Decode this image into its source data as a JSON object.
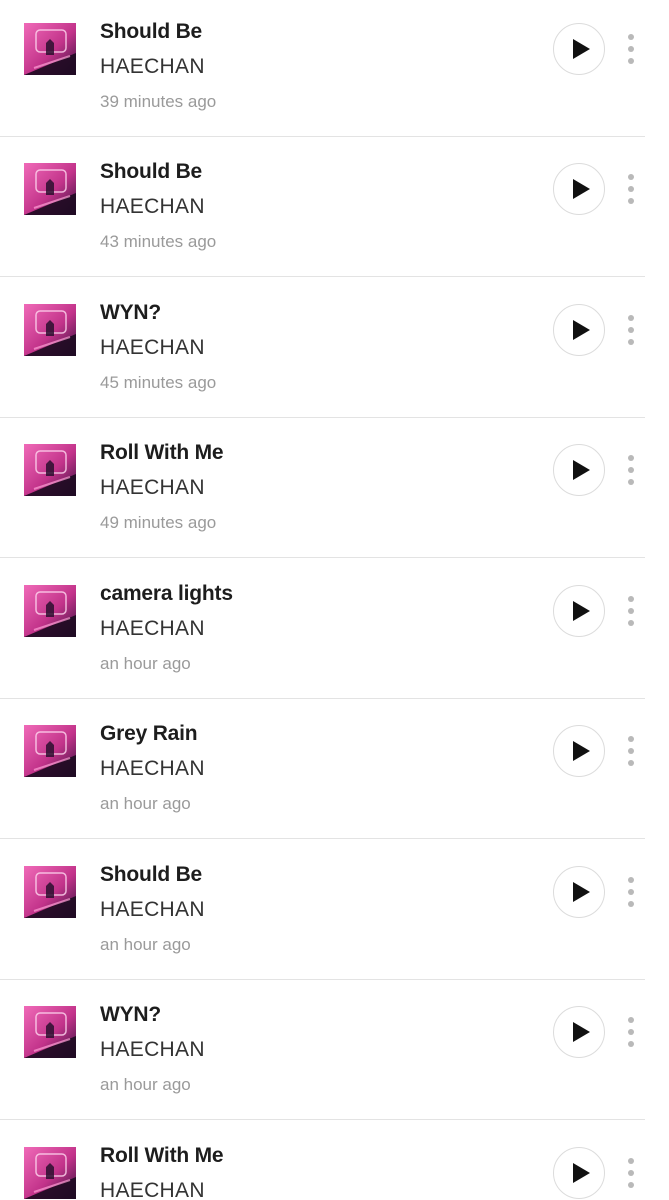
{
  "history": {
    "items": [
      {
        "title": "Should Be",
        "artist": "HAECHAN",
        "time": "39 minutes ago"
      },
      {
        "title": "Should Be",
        "artist": "HAECHAN",
        "time": "43 minutes ago"
      },
      {
        "title": "WYN?",
        "artist": "HAECHAN",
        "time": "45 minutes ago"
      },
      {
        "title": "Roll With Me",
        "artist": "HAECHAN",
        "time": "49 minutes ago"
      },
      {
        "title": "camera lights",
        "artist": "HAECHAN",
        "time": "an hour ago"
      },
      {
        "title": "Grey Rain",
        "artist": "HAECHAN",
        "time": "an hour ago"
      },
      {
        "title": "Should Be",
        "artist": "HAECHAN",
        "time": "an hour ago"
      },
      {
        "title": "WYN?",
        "artist": "HAECHAN",
        "time": "an hour ago"
      },
      {
        "title": "Roll With Me",
        "artist": "HAECHAN",
        "time": ""
      }
    ]
  },
  "icons": {
    "play": "play-icon",
    "more": "more-vertical-icon",
    "cover": "album-cover"
  },
  "colors": {
    "title": "#1d1d1d",
    "artist": "#333333",
    "timestamp": "#9a9a9a",
    "separator": "#e3e3e3",
    "play_icon": "#111111",
    "more_icon": "#b9b9b9",
    "cover_pink": "#e0479e",
    "cover_dark": "#2a0f2e"
  }
}
